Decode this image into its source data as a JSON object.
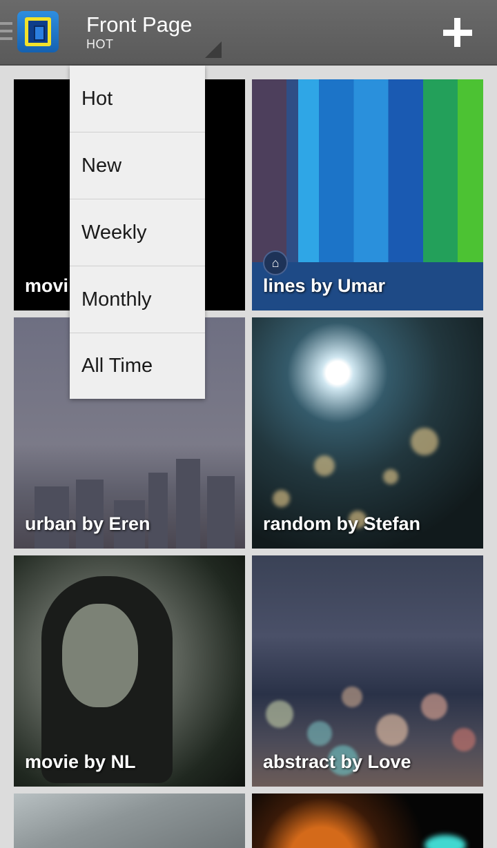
{
  "actionbar": {
    "title": "Front Page",
    "subtitle": "HOT",
    "add_icon": "plus-icon",
    "app_icon": "wallpaper-app-icon"
  },
  "sort_menu": {
    "items": [
      "Hot",
      "New",
      "Weekly",
      "Monthly",
      "All Time"
    ]
  },
  "grid": {
    "tiles": [
      {
        "label": "movie by Justin",
        "visible_label": "movi"
      },
      {
        "label": "lines by Umar",
        "badge_icon": "home-icon"
      },
      {
        "label": "urban by Eren"
      },
      {
        "label": "random by Stefan"
      },
      {
        "label": "movie by NL"
      },
      {
        "label": "abstract by Love"
      }
    ]
  },
  "colors": {
    "actionbar": "#5f5f5f",
    "background": "#dcdcdc",
    "menu": "#efefef"
  }
}
